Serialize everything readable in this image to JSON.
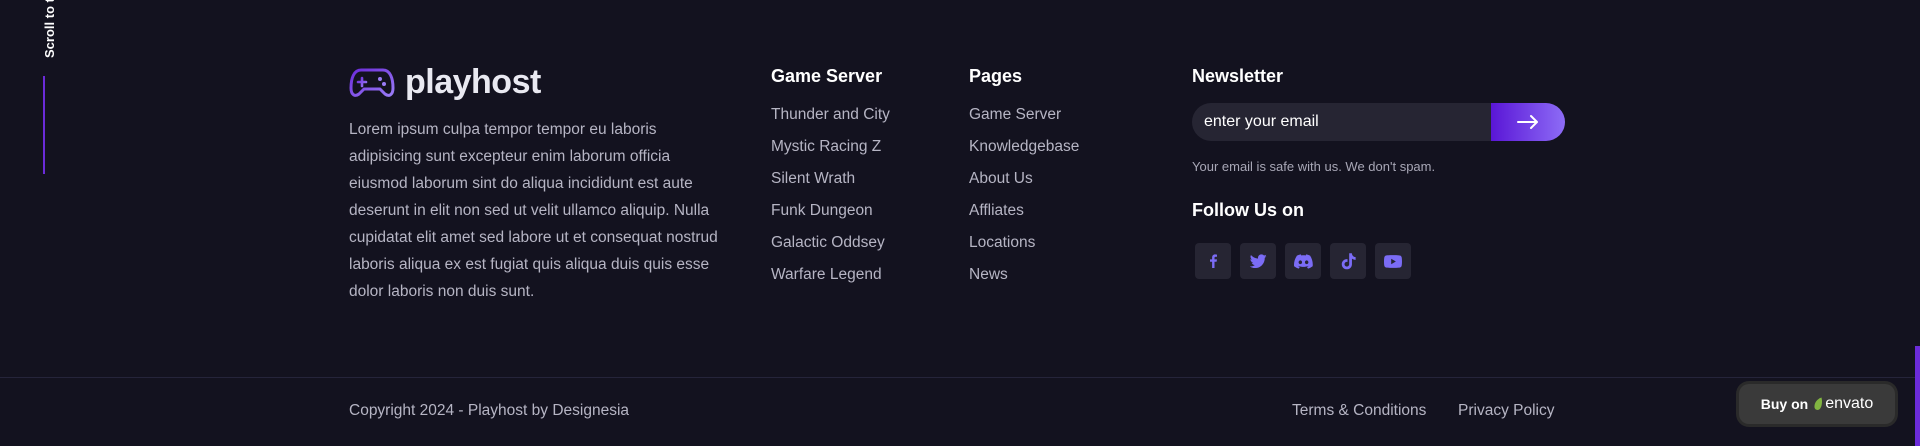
{
  "scroll": {
    "label": "Scroll to top"
  },
  "brand": {
    "name": "playhost",
    "about": "Lorem ipsum culpa tempor tempor eu laboris adipisicing sunt excepteur enim laborum officia eiusmod laborum sint do aliqua incididunt est aute deserunt in elit non sed ut velit ullamco aliquip. Nulla cupidatat elit amet sed labore ut et consequat nostrud laboris aliqua ex est fugiat quis aliqua duis quis esse dolor laboris non duis sunt."
  },
  "game_server": {
    "title": "Game Server",
    "items": [
      "Thunder and City",
      "Mystic Racing Z",
      "Silent Wrath",
      "Funk Dungeon",
      "Galactic Oddsey",
      "Warfare Legend"
    ]
  },
  "pages": {
    "title": "Pages",
    "items": [
      "Game Server",
      "Knowledgebase",
      "About Us",
      "Affliates",
      "Locations",
      "News"
    ]
  },
  "newsletter": {
    "title": "Newsletter",
    "placeholder": "enter your email",
    "note": "Your email is safe with us. We don't spam."
  },
  "follow": {
    "title": "Follow Us on",
    "icons": [
      "facebook-icon",
      "twitter-icon",
      "discord-icon",
      "tiktok-icon",
      "youtube-icon"
    ]
  },
  "bottom": {
    "copyright": "Copyright 2024 - Playhost by Designesia",
    "terms": "Terms & Conditions",
    "privacy": "Privacy Policy"
  },
  "envato": {
    "buy": "Buy on",
    "name": "envato"
  },
  "colors": {
    "background": "#13121f",
    "accent": "#6b2bd9",
    "accent_light": "#8d6cf6",
    "icon": "#7b6cf5"
  }
}
